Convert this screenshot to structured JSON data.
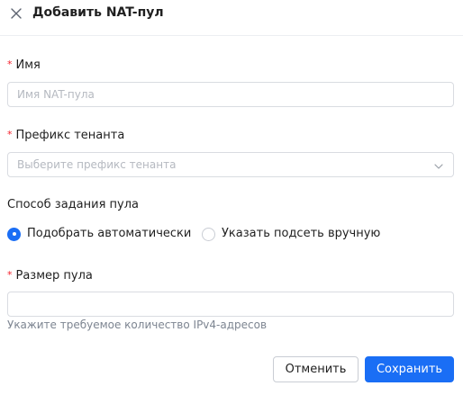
{
  "dialog": {
    "title": "Добавить NAT-пул",
    "close_icon": "close-icon"
  },
  "form": {
    "required_mark": "*",
    "name": {
      "label": "Имя",
      "placeholder": "Имя NAT-пула",
      "value": ""
    },
    "tenant_prefix": {
      "label": "Префикс тенанта",
      "placeholder": "Выберите префикс тенанта",
      "icon": "chevron-down-icon"
    },
    "pool_method": {
      "label": "Способ задания пула",
      "options": [
        {
          "label": "Подобрать автоматически",
          "selected": true
        },
        {
          "label": "Указать подсеть вручную",
          "selected": false
        }
      ]
    },
    "pool_size": {
      "label": "Размер пула",
      "value": "",
      "hint": "Укажите требуемое количество IPv4-адресов"
    }
  },
  "footer": {
    "cancel_label": "Отменить",
    "save_label": "Сохранить"
  },
  "colors": {
    "accent": "#1a6ef5",
    "required": "#f5222d",
    "border": "#d9dce1"
  }
}
